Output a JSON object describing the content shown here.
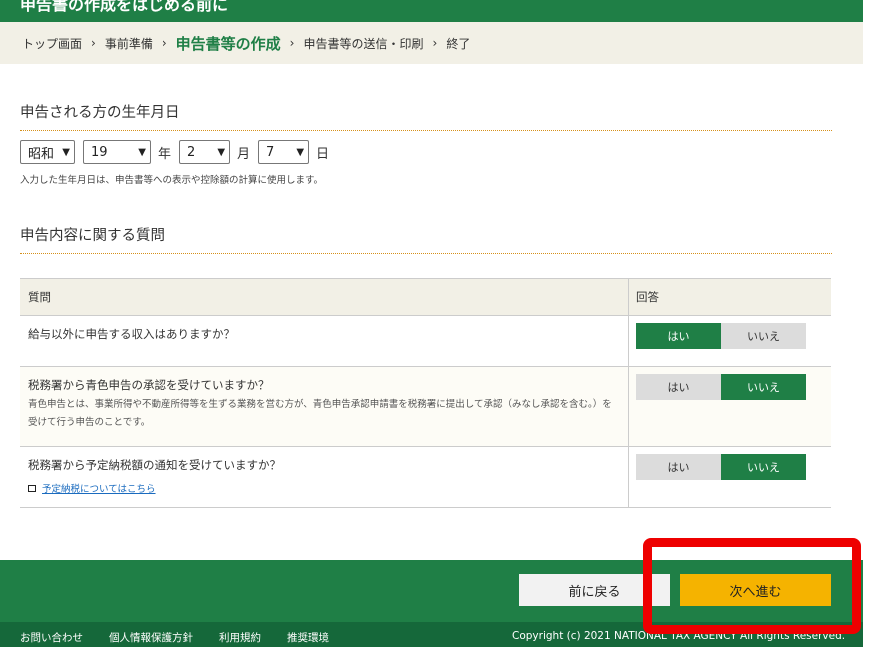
{
  "header": {
    "title": "申告書の作成をはじめる前に"
  },
  "breadcrumb": {
    "items": [
      "トップ画面",
      "事前準備",
      "申告書等の作成",
      "申告書等の送信・印刷",
      "終了"
    ],
    "separator": "›",
    "current_index": 2
  },
  "dob_section": {
    "heading": "申告される方の生年月日",
    "era": "昭和",
    "year": "19",
    "year_unit": "年",
    "month": "2",
    "month_unit": "月",
    "day": "7",
    "day_unit": "日",
    "hint": "入力した生年月日は、申告書等への表示や控除額の計算に使用します。"
  },
  "questions_section": {
    "heading": "申告内容に関する質問",
    "col_question": "質問",
    "col_answer": "回答",
    "yes_label": "はい",
    "no_label": "いいえ",
    "rows": [
      {
        "question": "給与以外に申告する収入はありますか？",
        "selected": "yes"
      },
      {
        "question": "税務署から青色申告の承認を受けていますか？",
        "sub": "青色申告とは、事業所得や不動産所得等を生ずる業務を営む方が、青色申告承認申請書を税務署に提出して承認（みなし承認を含む。）を受けて行う申告のことです。",
        "selected": "no"
      },
      {
        "question": "税務署から予定納税額の通知を受けていますか？",
        "link": "予定納税についてはこちら",
        "selected": "no"
      }
    ]
  },
  "footer": {
    "back_label": "前に戻る",
    "next_label": "次へ進む",
    "links": [
      "お問い合わせ",
      "個人情報保護方針",
      "利用規約",
      "推奨環境"
    ],
    "copyright": "Copyright (c) 2021 NATIONAL TAX AGENCY All Rights Reserved."
  },
  "colors": {
    "brand_green": "#1f7f46",
    "next_button": "#f5b300",
    "highlight": "#ee0000"
  }
}
